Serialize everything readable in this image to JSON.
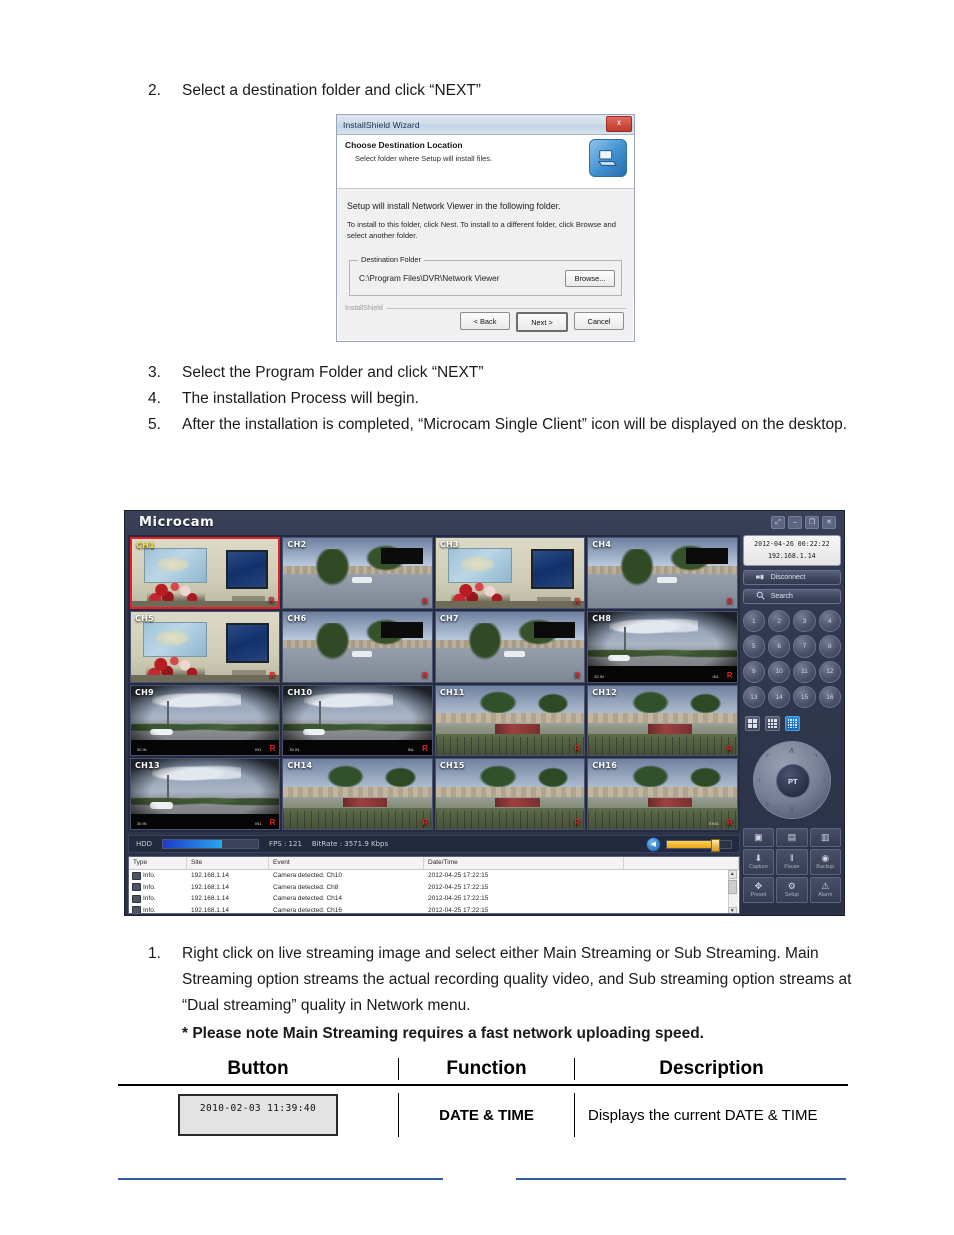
{
  "steps_top": [
    {
      "num": "2.",
      "text": "Select a destination folder and click “NEXT”"
    }
  ],
  "wizard": {
    "title": "InstallShield Wizard",
    "close_label": "x",
    "heading": "Choose Destination Location",
    "subheading": "Select folder where Setup will install files.",
    "body_line1": "Setup will install Network Viewer in the following folder.",
    "body_line2": "To install to this folder, click Nest. To install to a different folder, click Browse and select another folder.",
    "dest_legend": "Destination Folder",
    "dest_path": "C:\\Program Files\\DVR\\Network Viewer",
    "browse_label": "Browse...",
    "brand": "InstallShield",
    "back_label": "< Back",
    "next_label": "Next >",
    "cancel_label": "Cancel"
  },
  "steps_mid": [
    {
      "num": "3.",
      "text": "Select the Program Folder and click “NEXT”"
    },
    {
      "num": "4.",
      "text": "The installation Process will begin."
    },
    {
      "num": "5.",
      "text": " After the installation is completed, “Microcam Single Client” icon will be displayed on the desktop."
    }
  ],
  "app": {
    "logo": "Microcam",
    "window_controls": [
      {
        "name": "restore-all-icon",
        "glyph": "⤢"
      },
      {
        "name": "minimize-icon",
        "glyph": "–"
      },
      {
        "name": "maximize-icon",
        "glyph": "❐"
      },
      {
        "name": "close-icon",
        "glyph": "✕"
      }
    ],
    "channels": [
      {
        "label": "CH1",
        "scene": "room",
        "selected": true,
        "rec": "R",
        "osd_left": "",
        "osd_right": ""
      },
      {
        "label": "CH2",
        "scene": "park",
        "selected": false,
        "rec": "R",
        "osd_left": "",
        "osd_right": ""
      },
      {
        "label": "CH3",
        "scene": "room",
        "selected": false,
        "rec": "R",
        "osd_left": "",
        "osd_right": ""
      },
      {
        "label": "CH4",
        "scene": "park",
        "selected": false,
        "rec": "R",
        "osd_left": "",
        "osd_right": ""
      },
      {
        "label": "CH5",
        "scene": "room",
        "selected": false,
        "rec": "R",
        "osd_left": "",
        "osd_right": ""
      },
      {
        "label": "CH6",
        "scene": "park",
        "selected": false,
        "rec": "R",
        "osd_left": "",
        "osd_right": ""
      },
      {
        "label": "CH7",
        "scene": "park",
        "selected": false,
        "rec": "R",
        "osd_left": "",
        "osd_right": ""
      },
      {
        "label": "CH8",
        "scene": "road",
        "selected": false,
        "rec": "R",
        "osd_left": "30 IN",
        "osd_right": "IN1"
      },
      {
        "label": "CH9",
        "scene": "road",
        "selected": false,
        "rec": "R",
        "osd_left": "30 IN",
        "osd_right": "IN1"
      },
      {
        "label": "CH10",
        "scene": "road",
        "selected": false,
        "rec": "R",
        "osd_left": "30 IN",
        "osd_right": "IN1"
      },
      {
        "label": "CH11",
        "scene": "field",
        "selected": false,
        "rec": "R",
        "osd_left": "",
        "osd_right": ""
      },
      {
        "label": "CH12",
        "scene": "field",
        "selected": false,
        "rec": "R",
        "osd_left": "",
        "osd_right": ""
      },
      {
        "label": "CH13",
        "scene": "road",
        "selected": false,
        "rec": "R",
        "osd_left": "30 IN",
        "osd_right": "IN1"
      },
      {
        "label": "CH14",
        "scene": "field",
        "selected": false,
        "rec": "R",
        "osd_left": "",
        "osd_right": ""
      },
      {
        "label": "CH15",
        "scene": "field",
        "selected": false,
        "rec": "R",
        "osd_left": "",
        "osd_right": ""
      },
      {
        "label": "CH16",
        "scene": "field",
        "selected": false,
        "rec": "R",
        "osd_left": "",
        "osd_right": "XX01"
      }
    ],
    "status": {
      "hdd_label": "HDD",
      "hdd_percent": 62,
      "fps": "FPS : 121",
      "bitrate": "BitRate : 3571.9 Kbps",
      "speaker_icon": "◀",
      "volume_percent": 72
    },
    "log": {
      "columns": [
        "Type",
        "Site",
        "Event",
        "Date/Time"
      ],
      "rows": [
        {
          "type": "Info.",
          "site": "192.168.1.14",
          "event": "Camera detected. Ch10",
          "datetime": "2012-04-25 17:22:15"
        },
        {
          "type": "Info.",
          "site": "192.168.1.14",
          "event": "Camera detected. Ch8",
          "datetime": "2012-04-25 17:22:15"
        },
        {
          "type": "Info.",
          "site": "192.168.1.14",
          "event": "Camera detected. Ch14",
          "datetime": "2012-04-25 17:22:15"
        },
        {
          "type": "Info.",
          "site": "192.168.1.14",
          "event": "Camera detected. Ch16",
          "datetime": "2012-04-25 17:22:15"
        }
      ],
      "scroll_up": "▲",
      "scroll_down": "▼"
    },
    "panel": {
      "datetime": "2012-04-26 00:22:22",
      "ip": "192.168.1.14",
      "disconnect_label": "Disconnect",
      "search_label": "Search",
      "keypad": [
        "1",
        "2",
        "3",
        "4",
        "5",
        "6",
        "7",
        "8",
        "9",
        "10",
        "11",
        "12",
        "13",
        "14",
        "15",
        "16"
      ],
      "layouts": [
        {
          "name": "layout-4-split",
          "cells": 4,
          "active": false
        },
        {
          "name": "layout-9-split",
          "cells": 9,
          "active": false
        },
        {
          "name": "layout-16-split",
          "cells": 16,
          "active": true
        }
      ],
      "ptz_center": "PT",
      "ptz_arrows": {
        "up": "∧",
        "down": "∨",
        "left": "‹",
        "right": "›"
      },
      "tools_row1": [
        {
          "name": "live-view-button",
          "glyph": "▣",
          "caption": ""
        },
        {
          "name": "playback-button",
          "glyph": "▤",
          "caption": ""
        },
        {
          "name": "remote-setup-button",
          "glyph": "▥",
          "caption": ""
        }
      ],
      "tools_row2": [
        {
          "name": "capture-button",
          "glyph": "⬇",
          "caption": "Capture"
        },
        {
          "name": "pause-button",
          "glyph": "‖",
          "caption": "Pause"
        },
        {
          "name": "backup-button",
          "glyph": "◉",
          "caption": "Backup"
        }
      ],
      "tools_row3": [
        {
          "name": "preset-button",
          "glyph": "✥",
          "caption": "Preset"
        },
        {
          "name": "setup-button",
          "glyph": "⚙",
          "caption": "Setup"
        },
        {
          "name": "alarm-button",
          "glyph": "⚠",
          "caption": "Alarm"
        }
      ]
    }
  },
  "steps_bottom": [
    {
      "num": "1.",
      "text": "Right click on live streaming image and select either Main Streaming or Sub Streaming. Main Streaming option streams the actual recording quality video, and Sub streaming option streams at “Dual streaming” quality in Network menu.",
      "note": "* Please note Main Streaming requires a fast network uploading speed."
    }
  ],
  "reference_table": {
    "headers": [
      "Button",
      "Function",
      "Description"
    ],
    "rows": [
      {
        "button_chip": "2010-02-03 11:39:40",
        "function": "DATE & TIME",
        "description": "Displays the current DATE & TIME"
      }
    ]
  },
  "colors": {
    "accent_blue": "#2d8ddd",
    "selection_red": "#ec1c24",
    "footer_rule": "#2f5f9e",
    "panel_bg": "#2b3147"
  }
}
